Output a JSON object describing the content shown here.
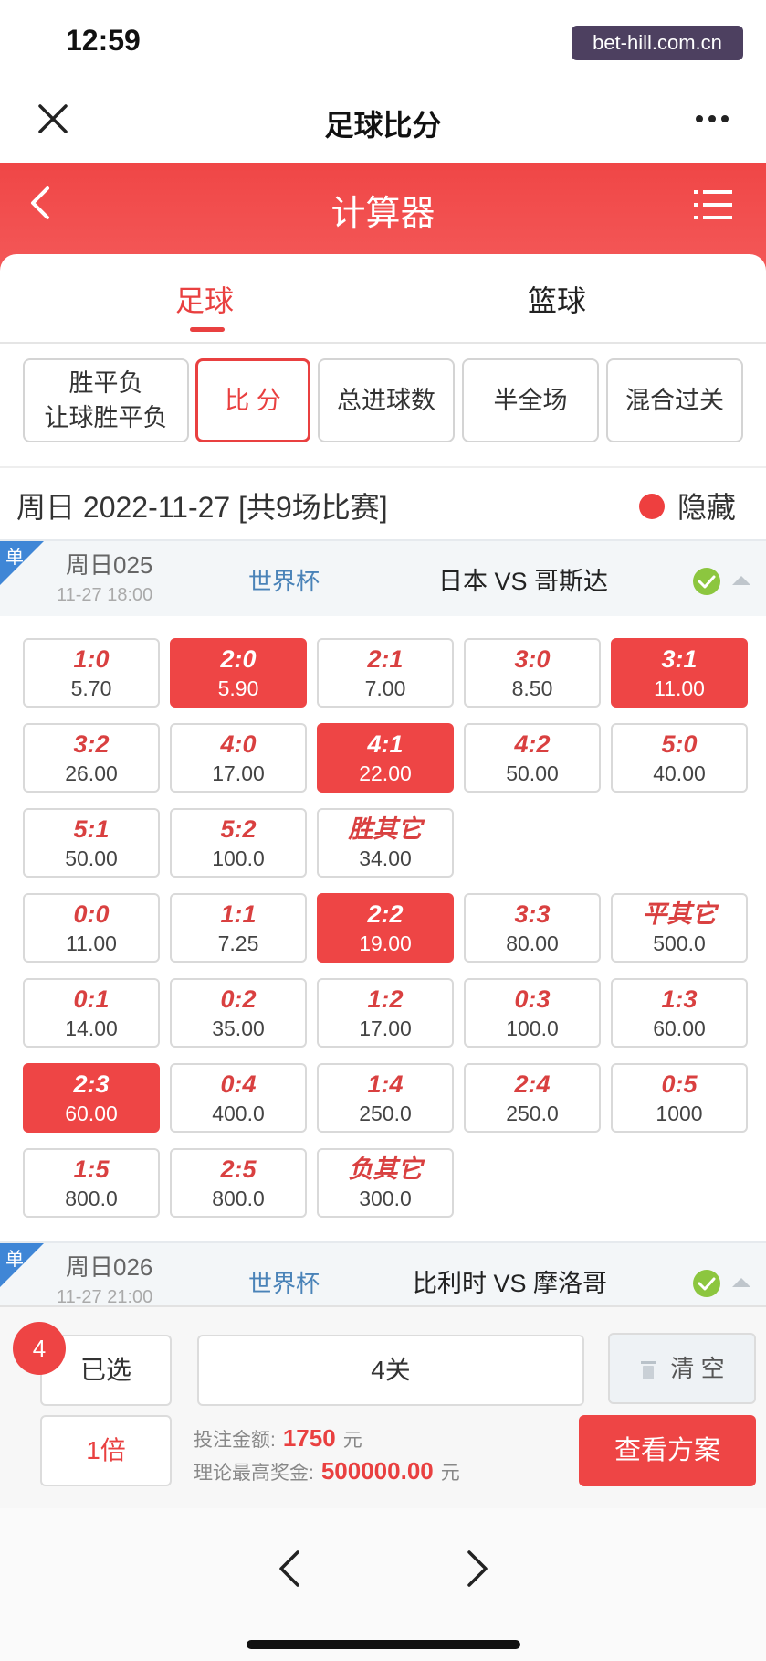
{
  "status": {
    "time": "12:59",
    "watermark": "bet-hill.com.cn"
  },
  "window": {
    "title": "足球比分"
  },
  "header": {
    "title": "计算器"
  },
  "sport_tabs": [
    {
      "label": "足球",
      "active": true
    },
    {
      "label": "篮球",
      "active": false
    }
  ],
  "play_types": [
    {
      "line1": "胜平负",
      "line2": "让球胜平负",
      "active": false
    },
    {
      "line1": "比 分",
      "line2": "",
      "active": true
    },
    {
      "line1": "总进球数",
      "line2": "",
      "active": false
    },
    {
      "line1": "半全场",
      "line2": "",
      "active": false
    },
    {
      "line1": "混合过关",
      "line2": "",
      "active": false
    }
  ],
  "date_bar": {
    "text": "周日 2022-11-27 [共9场比赛]",
    "hide_label": "隐藏"
  },
  "matches": [
    {
      "badge": "单",
      "no": "周日025",
      "time": "11-27 18:00",
      "league": "世界杯",
      "teams": "日本 VS 哥斯达",
      "checked": true,
      "odds_rows": [
        [
          {
            "score": "1:0",
            "odds": "5.70",
            "selected": false
          },
          {
            "score": "2:0",
            "odds": "5.90",
            "selected": true
          },
          {
            "score": "2:1",
            "odds": "7.00",
            "selected": false
          },
          {
            "score": "3:0",
            "odds": "8.50",
            "selected": false
          },
          {
            "score": "3:1",
            "odds": "11.00",
            "selected": true
          }
        ],
        [
          {
            "score": "3:2",
            "odds": "26.00",
            "selected": false
          },
          {
            "score": "4:0",
            "odds": "17.00",
            "selected": false
          },
          {
            "score": "4:1",
            "odds": "22.00",
            "selected": true
          },
          {
            "score": "4:2",
            "odds": "50.00",
            "selected": false
          },
          {
            "score": "5:0",
            "odds": "40.00",
            "selected": false
          }
        ],
        [
          {
            "score": "5:1",
            "odds": "50.00",
            "selected": false
          },
          {
            "score": "5:2",
            "odds": "100.0",
            "selected": false
          },
          {
            "score": "胜其它",
            "odds": "34.00",
            "selected": false
          }
        ],
        [
          {
            "score": "0:0",
            "odds": "11.00",
            "selected": false
          },
          {
            "score": "1:1",
            "odds": "7.25",
            "selected": false
          },
          {
            "score": "2:2",
            "odds": "19.00",
            "selected": true
          },
          {
            "score": "3:3",
            "odds": "80.00",
            "selected": false
          },
          {
            "score": "平其它",
            "odds": "500.0",
            "selected": false
          }
        ],
        [
          {
            "score": "0:1",
            "odds": "14.00",
            "selected": false
          },
          {
            "score": "0:2",
            "odds": "35.00",
            "selected": false
          },
          {
            "score": "1:2",
            "odds": "17.00",
            "selected": false
          },
          {
            "score": "0:3",
            "odds": "100.0",
            "selected": false
          },
          {
            "score": "1:3",
            "odds": "60.00",
            "selected": false
          }
        ],
        [
          {
            "score": "2:3",
            "odds": "60.00",
            "selected": true
          },
          {
            "score": "0:4",
            "odds": "400.0",
            "selected": false
          },
          {
            "score": "1:4",
            "odds": "250.0",
            "selected": false
          },
          {
            "score": "2:4",
            "odds": "250.0",
            "selected": false
          },
          {
            "score": "0:5",
            "odds": "1000",
            "selected": false
          }
        ],
        [
          {
            "score": "1:5",
            "odds": "800.0",
            "selected": false
          },
          {
            "score": "2:5",
            "odds": "800.0",
            "selected": false
          },
          {
            "score": "负其它",
            "odds": "300.0",
            "selected": false
          }
        ]
      ]
    },
    {
      "badge": "单",
      "no": "周日026",
      "time": "11-27 21:00",
      "league": "世界杯",
      "teams": "比利时 VS 摩洛哥",
      "checked": true
    }
  ],
  "bottom": {
    "count": "4",
    "selected_label": "已选",
    "pass_label": "4关",
    "clear_label": "清 空",
    "multiplier": "1倍",
    "bet_amount_label": "投注金额:",
    "bet_amount": "1750",
    "max_prize_label": "理论最高奖金:",
    "max_prize": "500000.00",
    "currency": "元",
    "view_label": "查看方案"
  },
  "icons": {
    "close": "close-icon",
    "more": "more-icon",
    "back": "back-icon",
    "menu": "menu-icon",
    "check": "check-circle-icon",
    "collapse": "chevron-up-icon",
    "trash": "trash-icon",
    "nav_back": "nav-back-icon",
    "nav_forward": "nav-forward-icon"
  },
  "colors": {
    "accent": "#ee4545",
    "league": "#4a83b8",
    "check": "#8cc63f"
  }
}
